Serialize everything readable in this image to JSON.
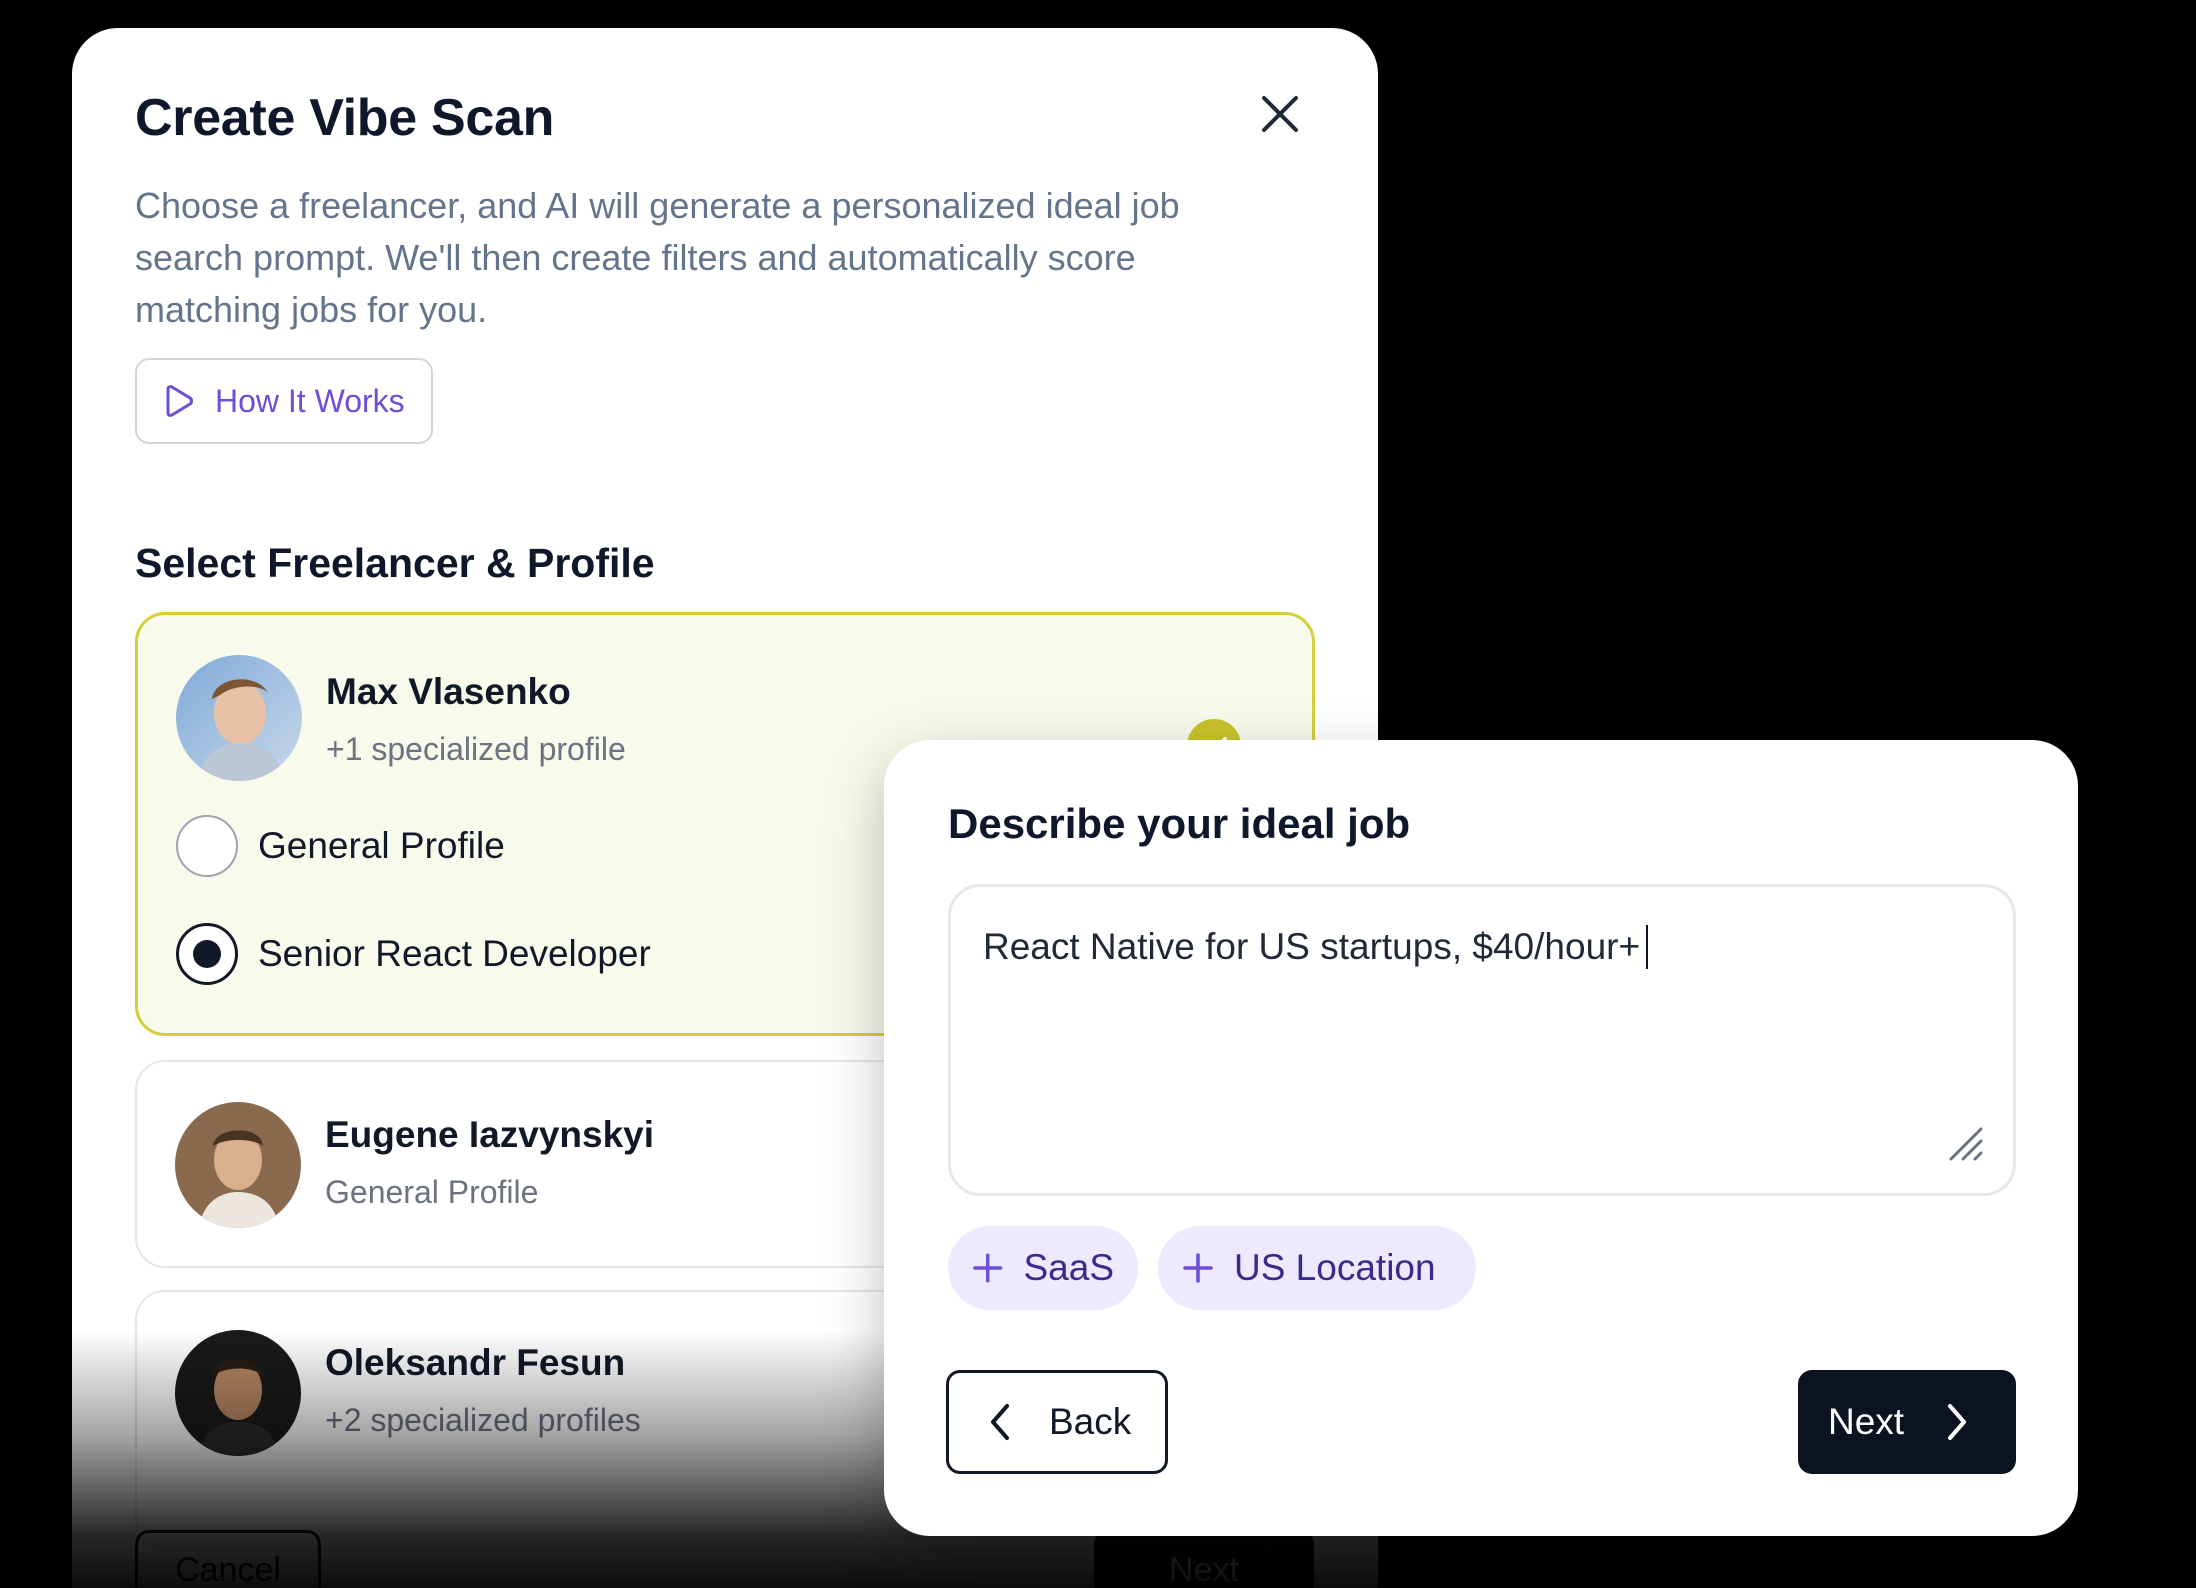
{
  "back_modal": {
    "title": "Create Vibe Scan",
    "description": "Choose a freelancer, and AI will generate a personalized ideal job search prompt. We'll then create filters and automatically score matching jobs for you.",
    "how_it_works_label": "How It Works",
    "section_title": "Select Freelancer & Profile",
    "freelancers": [
      {
        "name": "Max Vlasenko",
        "subtitle": "+1 specialized profile",
        "selected": true,
        "profiles": [
          {
            "label": "General Profile",
            "checked": false
          },
          {
            "label": "Senior React Developer",
            "checked": true
          }
        ]
      },
      {
        "name": "Eugene Iazvynskyi",
        "subtitle": "General Profile",
        "selected": false
      },
      {
        "name": "Oleksandr Fesun",
        "subtitle": "+2 specialized profiles",
        "selected": false
      }
    ],
    "footer": {
      "cancel_label": "Cancel",
      "next_label": "Next"
    }
  },
  "front_modal": {
    "title": "Describe your ideal job",
    "job_input_value": "React Native for US startups, $40/hour+",
    "suggestions": [
      {
        "label": "SaaS",
        "icon": "plus-icon"
      },
      {
        "label": "US Location",
        "icon": "plus-icon"
      }
    ],
    "back_label": "Back",
    "next_label": "Next"
  },
  "colors": {
    "accent_purple": "#6d4ed9",
    "selected_card_bg": "#f8faec",
    "selected_card_border": "#d4cf3a",
    "check_badge": "#c9c42a",
    "chip_bg": "#ede9fe",
    "primary_button": "#0b1220"
  },
  "icons": [
    "close-icon",
    "play-icon",
    "check-icon",
    "plus-icon",
    "chevron-left-icon",
    "chevron-right-icon",
    "resize-handle-icon"
  ]
}
